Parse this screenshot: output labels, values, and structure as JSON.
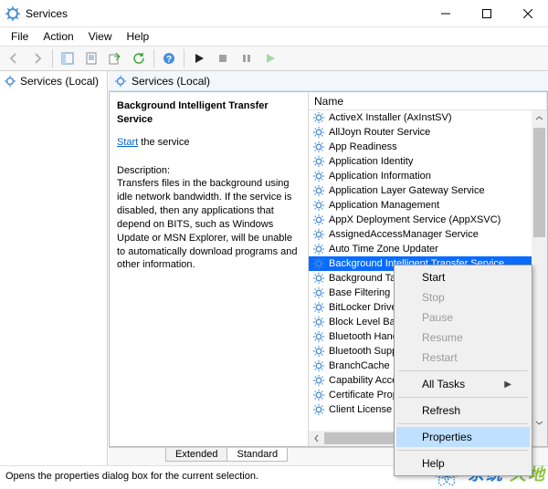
{
  "window": {
    "title": "Services"
  },
  "menu": {
    "file": "File",
    "action": "Action",
    "view": "View",
    "help": "Help"
  },
  "tree": {
    "root": "Services (Local)"
  },
  "rightHeader": "Services (Local)",
  "detail": {
    "serviceName": "Background Intelligent Transfer Service",
    "startLink": "Start",
    "startText": " the service",
    "descHeading": "Description:",
    "description": "Transfers files in the background using idle network bandwidth. If the service is disabled, then any applications that depend on BITS, such as Windows Update or MSN Explorer, will be unable to automatically download programs and other information."
  },
  "columns": {
    "name": "Name"
  },
  "services": [
    "ActiveX Installer (AxInstSV)",
    "AllJoyn Router Service",
    "App Readiness",
    "Application Identity",
    "Application Information",
    "Application Layer Gateway Service",
    "Application Management",
    "AppX Deployment Service (AppXSVC)",
    "AssignedAccessManager Service",
    "Auto Time Zone Updater",
    "Background Intelligent Transfer Service",
    "Background Tasks Infrastructure Service",
    "Base Filtering Engine",
    "BitLocker Drive Encryption Service",
    "Block Level Backup Engine Service",
    "Bluetooth Handsfree Service",
    "Bluetooth Support Service",
    "BranchCache",
    "Capability Access Manager Service",
    "Certificate Propagation",
    "Client License Service (ClipSVC)"
  ],
  "selectedIndex": 10,
  "tabs": {
    "extended": "Extended",
    "standard": "Standard"
  },
  "context": {
    "start": "Start",
    "stop": "Stop",
    "pause": "Pause",
    "resume": "Resume",
    "restart": "Restart",
    "allTasks": "All Tasks",
    "refresh": "Refresh",
    "properties": "Properties",
    "help": "Help"
  },
  "status": "Opens the properties dialog box for the current selection.",
  "watermark": {
    "t1": "系统",
    "t2": "天地"
  }
}
